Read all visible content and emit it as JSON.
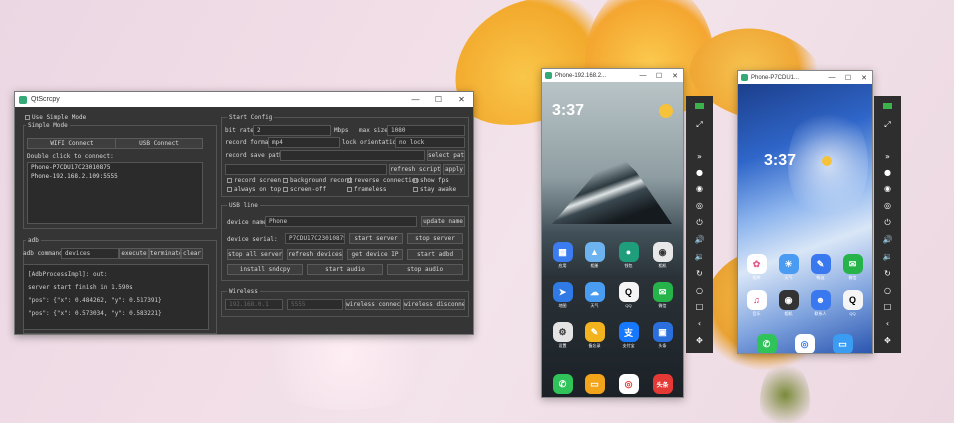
{
  "qtscrcpy": {
    "title": "QtScrcpy",
    "use_simple_mode": "Use Simple Mode",
    "simple_mode_group": "Simple Mode",
    "wifi_connect": "WIFI Connect",
    "usb_connect": "USB Connect",
    "double_click_label": "Double click to connect:",
    "devices": [
      "Phone-P7CDU17C23010875",
      "Phone-192.168.2.109:5555"
    ],
    "adb_group": "adb",
    "adb_command_label": "adb command:",
    "adb_command_value": "devices",
    "execute": "execute",
    "terminate": "terminate",
    "clear": "clear",
    "log": [
      "[AdbProcessImpl]: out:",
      "server start finish in 1.590s",
      "\"pos\": {\"x\": 0.484262, \"y\": 0.517391}",
      "\"pos\": {\"x\": 0.573034, \"y\": 0.583221}"
    ],
    "start_config": {
      "title": "Start Config",
      "bit_rate_label": "bit rate:",
      "bit_rate_value": "2",
      "bit_rate_unit": "Mbps",
      "max_size_label": "max size:",
      "max_size_value": "1080",
      "record_format_label": "record format:",
      "record_format_value": "mp4",
      "lock_orientation_label": "lock orientation:",
      "lock_orientation_value": "no lock",
      "record_save_path_label": "record save path:",
      "select_path": "select path",
      "refresh_script": "refresh script",
      "apply": "apply",
      "checks": [
        "record screen",
        "background record",
        "reverse connection",
        "show fps",
        "always on top",
        "screen-off",
        "frameless",
        "stay awake"
      ]
    },
    "usb_line": {
      "title": "USB line",
      "device_name_label": "device name:",
      "device_name_value": "Phone",
      "update_name": "update name",
      "device_serial_label": "device serial:",
      "device_serial_value": "P7CDU17C23010875",
      "start_server": "start server",
      "stop_server": "stop server",
      "stop_all_server": "stop all server",
      "refresh_devices": "refresh devices",
      "get_device_ip": "get device IP",
      "start_adbd": "start adbd",
      "install_sndcpy": "install sndcpy",
      "start_audio": "start audio",
      "stop_audio": "stop audio"
    },
    "wireless": {
      "title": "Wireless",
      "ip_placeholder": "192.168.0.1",
      "port_placeholder": "5555",
      "wireless_connect": "wireless connect",
      "wireless_disconnect": "wireless disconnect"
    }
  },
  "phone1": {
    "title": "Phone-192.168.2...",
    "time": "3:37",
    "apps_row1": [
      "应用",
      "相册",
      "钱包",
      "相机"
    ],
    "apps_row2": [
      "地图",
      "天气",
      "QQ",
      "微信"
    ],
    "apps_row3": [
      "设置",
      "备忘录",
      "支付宝",
      "头条"
    ],
    "dock": [
      "电话",
      "信息",
      "Chrome",
      "头条"
    ]
  },
  "phone2": {
    "title": "Phone-P7CDU1...",
    "time": "3:37",
    "apps_row1": [
      "图库",
      "天气",
      "畅连",
      "微信"
    ],
    "apps_row2": [
      "音乐",
      "相机",
      "联系人",
      "QQ"
    ],
    "dock": [
      "电话",
      "浏览器",
      "信息"
    ]
  },
  "toolbar_icons": [
    "wifi-icon",
    "fullscreen-icon",
    "expand-icon",
    "power-dot-icon",
    "eye-icon",
    "eye-off-icon",
    "power-icon",
    "volume-up-icon",
    "volume-down-icon",
    "rotate-icon",
    "home-icon",
    "recent-icon",
    "back-icon",
    "touch-icon"
  ],
  "colors": {
    "panel": "#353535",
    "wallpaper": "#efdce5",
    "petal": "#f4b53a"
  }
}
